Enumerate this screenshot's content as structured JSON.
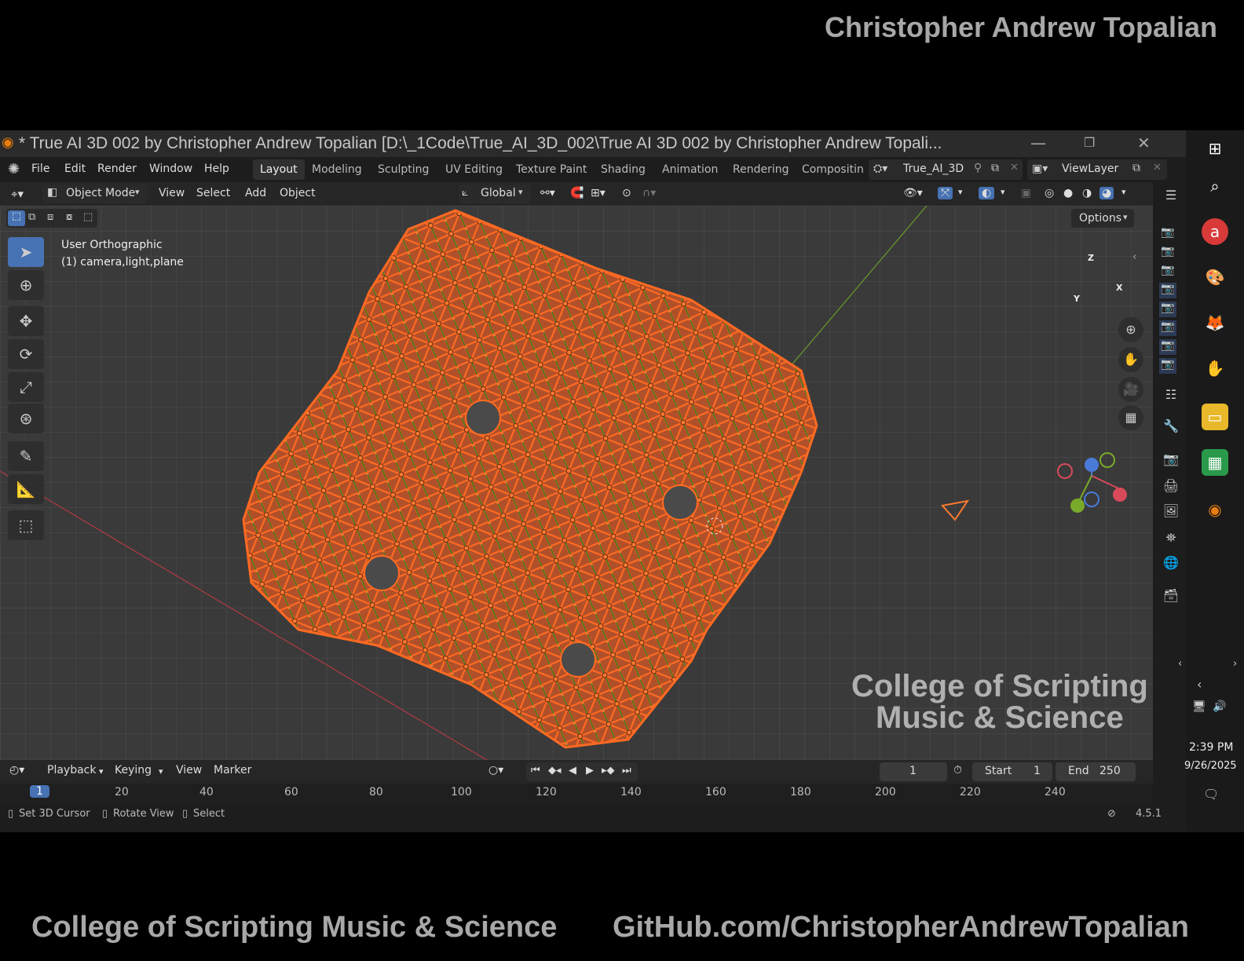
{
  "banner": {
    "top_name": "Christopher Andrew Topalian",
    "bottom_left": "College of Scripting Music & Science",
    "bottom_right": "GitHub.com/ChristopherAndrewTopalian"
  },
  "window": {
    "title": "* True AI 3D 002 by Christopher Andrew Topalian [D:\\_1Code\\True_AI_3D_002\\True AI 3D 002 by Christopher Andrew Topali...",
    "minimize": "—",
    "restore": "❐",
    "close": "✕"
  },
  "menubar": {
    "items": [
      "File",
      "Edit",
      "Render",
      "Window",
      "Help"
    ],
    "workspaces": [
      "Layout",
      "Modeling",
      "Sculpting",
      "UV Editing",
      "Texture Paint",
      "Shading",
      "Animation",
      "Rendering",
      "Compositin"
    ],
    "active_workspace": "Layout",
    "scene_name": "True_AI_3D",
    "view_layer": "ViewLayer"
  },
  "viewport_header": {
    "mode": "Object Mode",
    "menus": [
      "View",
      "Select",
      "Add",
      "Object"
    ],
    "transform_orientation": "Global",
    "options": "Options"
  },
  "viewport": {
    "view_name": "User Orthographic",
    "collection_info": "(1) camera,light,plane",
    "watermark_line1": "College of Scripting",
    "watermark_line2": "Music & Science",
    "axis_x": "X",
    "axis_y": "Y",
    "axis_z": "Z"
  },
  "tools": [
    "select-box",
    "cursor",
    "move",
    "rotate",
    "scale",
    "transform",
    "annotate",
    "measure",
    "add-cube"
  ],
  "timeline": {
    "menus": [
      "Playback",
      "Keying",
      "View",
      "Marker"
    ],
    "current_frame": "1",
    "start_label": "Start",
    "start": "1",
    "end_label": "End",
    "end": "250",
    "ruler": [
      "1",
      "20",
      "40",
      "60",
      "80",
      "100",
      "120",
      "140",
      "160",
      "180",
      "200",
      "220",
      "240"
    ]
  },
  "statusbar": {
    "hints": [
      "Set 3D Cursor",
      "Rotate View",
      "Select"
    ],
    "version": "4.5.1"
  },
  "taskbar": {
    "time": "2:39 PM",
    "date": "9/26/2025"
  }
}
